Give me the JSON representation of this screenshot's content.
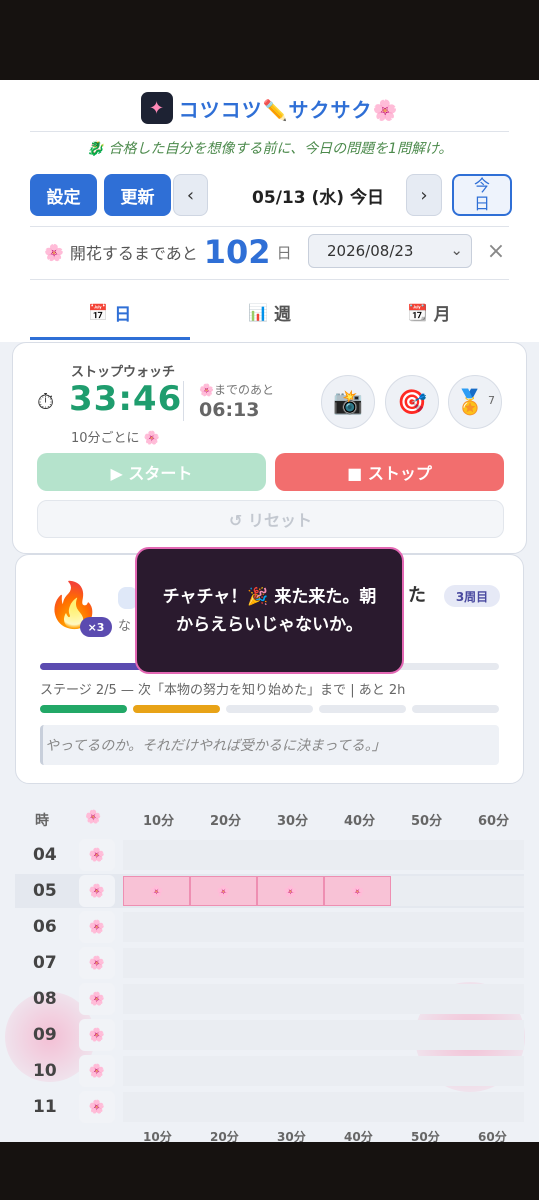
{
  "app": {
    "title": "コツコツ✏️サクサク🌸",
    "icon": "magic-wand-icon",
    "motto": "🐉 合格した自分を想像する前に、今日の問題を1問解け。"
  },
  "toolbar": {
    "settings_label": "設定",
    "refresh_label": "更新",
    "prev_label": "‹",
    "next_label": "›",
    "date_label": "05/13 (水) 今日",
    "today_label": "今日"
  },
  "countdown": {
    "flower": "🌸",
    "prefix": "開花するまであと",
    "days": "102",
    "unit": "日",
    "target_date": "2026/08/23",
    "close_label": "×"
  },
  "tabs": [
    {
      "icon": "📅",
      "label": "日",
      "active": true
    },
    {
      "icon": "📊",
      "label": "週",
      "active": false
    },
    {
      "icon": "📆",
      "label": "月",
      "active": false
    }
  ],
  "stopwatch": {
    "icon": "⏱",
    "label": "ストップウォッチ",
    "time": "33:46",
    "every": "10分ごとに 🌸",
    "remain_label": "🌸までのあと",
    "remain_value": "06:13",
    "camera_icon": "📸",
    "target_icon": "🎯",
    "medal_icon": "🏅",
    "medal_count": "7",
    "start_label": "▶ スタート",
    "stop_label": "■ ストップ",
    "reset_label": "↺ リセット"
  },
  "streak": {
    "fire_icon": "🔥",
    "multiplier": "×3",
    "peek_line2": "な",
    "peek_title_tail": "た",
    "week_badge": "3周目",
    "progress": 0.42,
    "stage_text": "ステージ 2/5 — 次「本物の努力を知り始めた」まで | あと 2h",
    "segments": [
      "#22a867",
      "#e8a317",
      "#e6e9ef",
      "#e6e9ef",
      "#e6e9ef"
    ],
    "quote": "やってるのか。それだけやれば受かるに決まってる。」"
  },
  "toast": {
    "message": "チャチャ！🎉 来た来た。朝からえらいじゃないか。"
  },
  "grid": {
    "hour_header": "時",
    "flower_header": "🌸",
    "columns": [
      "10分",
      "20分",
      "30分",
      "40分",
      "50分",
      "60分"
    ],
    "rows": [
      {
        "hour": "04",
        "filled": 0
      },
      {
        "hour": "05",
        "filled": 4
      },
      {
        "hour": "06",
        "filled": 0
      },
      {
        "hour": "07",
        "filled": 0
      },
      {
        "hour": "08",
        "filled": 0
      },
      {
        "hour": "09",
        "filled": 0
      },
      {
        "hour": "10",
        "filled": 0
      },
      {
        "hour": "11",
        "filled": 0
      }
    ],
    "cell_flower": "🌸"
  }
}
